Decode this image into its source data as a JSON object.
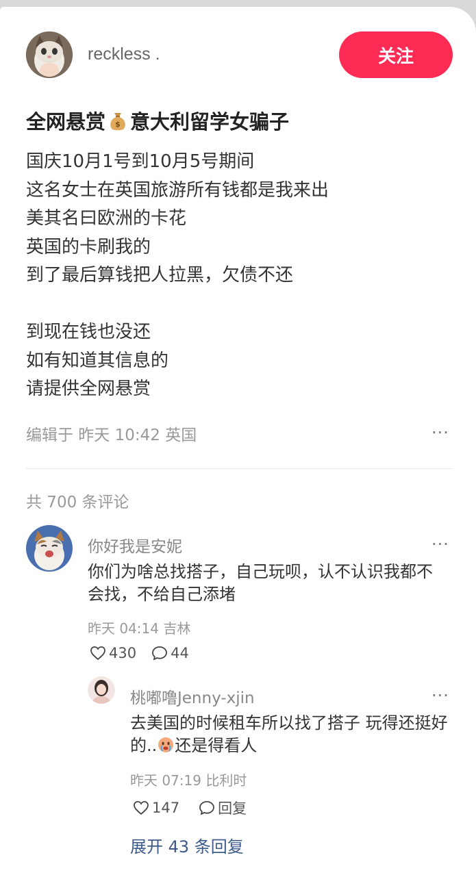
{
  "author": {
    "name": "reckless .",
    "follow_label": "关注"
  },
  "post": {
    "title_before": "全网悬赏",
    "title_icon": "money-bag-icon",
    "title_after": "意大利留学女骗子",
    "body_lines_1": [
      "国庆10月1号到10月5号期间",
      "这名女士在英国旅游所有钱都是我来出",
      "美其名曰欧洲的卡花",
      "英国的卡刷我的",
      "到了最后算钱把人拉黑，欠债不还"
    ],
    "body_lines_2": [
      "到现在钱也没还",
      "如有知道其信息的",
      "请提供全网悬赏"
    ],
    "meta": "编辑于 昨天 10:42 英国",
    "more": "···"
  },
  "comments_header": "共 700 条评论",
  "comments": [
    {
      "user": "你好我是安妮",
      "text": "你们为啥总找搭子，自己玩呗，认不认识我都不会找，不给自己添堵",
      "meta": "昨天 04:14 吉林",
      "likes": "430",
      "replies": "44",
      "more": "···"
    }
  ],
  "reply": {
    "user": "桃嘟噜Jenny-xjin",
    "text_before": "去美国的时候租车所以找了搭子 玩得还挺好的..",
    "text_icon": "crying-face-icon",
    "text_after": "还是得看人",
    "meta": "昨天 07:19 比利时",
    "likes": "147",
    "reply_label": "回复",
    "more": "···"
  },
  "expand_replies": "展开 43 条回复",
  "colors": {
    "accent": "#fe2c55",
    "link": "#3d5a8c"
  }
}
